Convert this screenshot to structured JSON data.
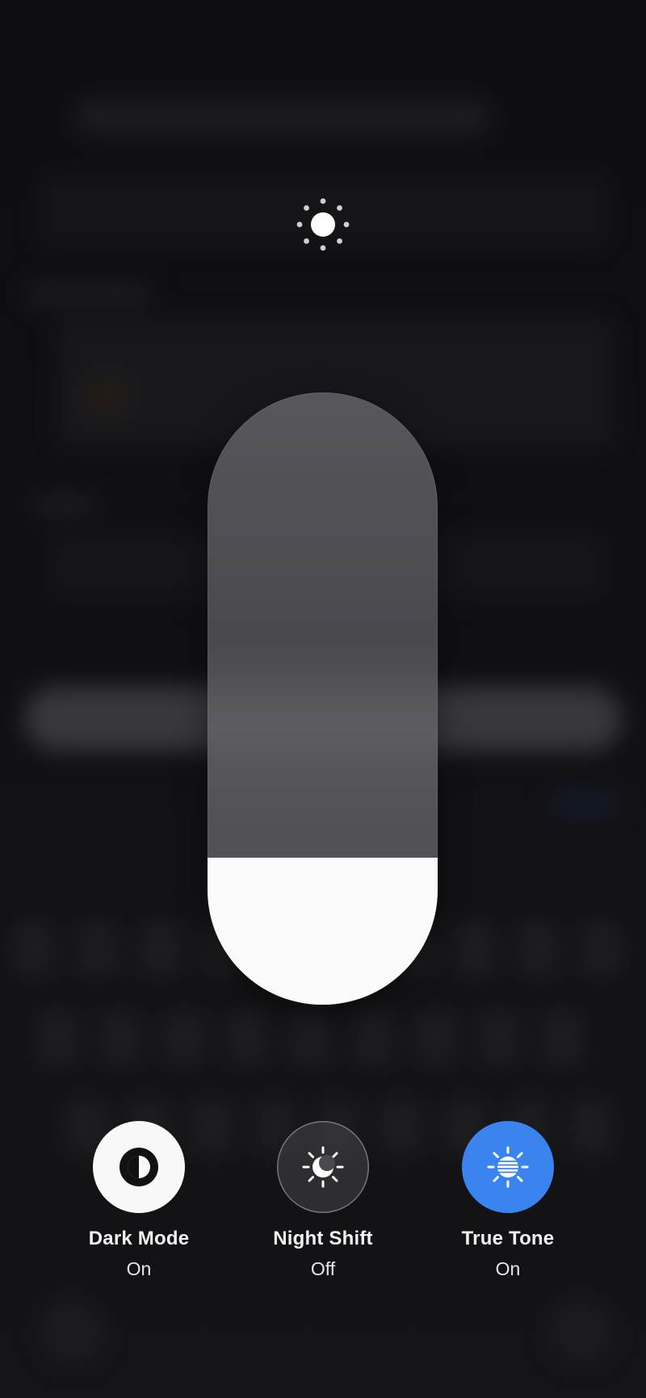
{
  "brightness": {
    "level_fraction": 0.24
  },
  "toggles": [
    {
      "label": "Dark Mode",
      "state": "On",
      "icon": "dark-mode-icon"
    },
    {
      "label": "Night Shift",
      "state": "Off",
      "icon": "night-shift-icon"
    },
    {
      "label": "True Tone",
      "state": "On",
      "icon": "true-tone-icon"
    }
  ],
  "colors": {
    "accent": "#3a84f0",
    "active_white": "#f8f8f8",
    "background": "#141416"
  }
}
